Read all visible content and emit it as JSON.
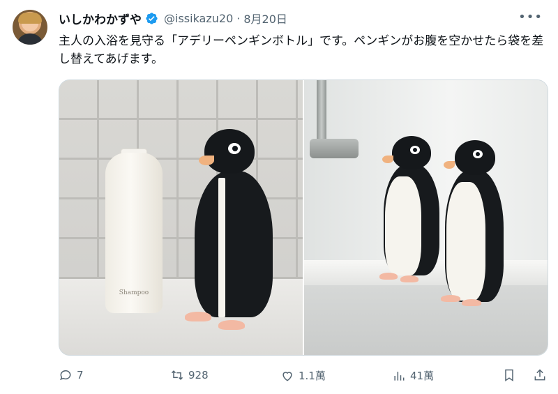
{
  "tweet": {
    "author_name": "いしかわかずや",
    "handle": "@issikazu20",
    "separator": "·",
    "date": "8月20日",
    "text": "主人の入浴を見守る「アデリーペンギンボトル」です。ペンギンがお腹を空かせたら袋を差し替えてあげます。",
    "verified": true
  },
  "media": {
    "left_image_label": "Shampoo"
  },
  "actions": {
    "replies": "7",
    "reposts": "928",
    "likes": "1.1萬",
    "views": "41萬"
  },
  "icons": [
    "verified-badge-icon",
    "more-icon",
    "reply-icon",
    "repost-icon",
    "like-icon",
    "views-icon",
    "bookmark-icon",
    "share-icon"
  ],
  "colors": {
    "text_primary": "#0f1419",
    "text_secondary": "#536471",
    "verified": "#1d9bf0"
  }
}
